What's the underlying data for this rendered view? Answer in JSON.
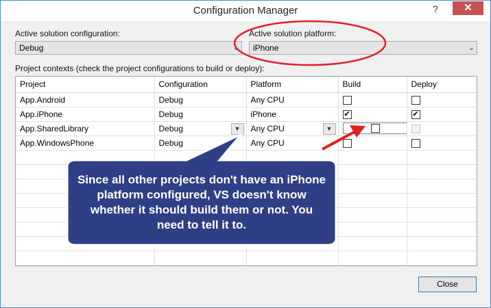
{
  "window": {
    "title": "Configuration Manager",
    "help_label": "?",
    "close_label": "✕"
  },
  "config": {
    "active_config_label": "Active solution configuration:",
    "active_config_value": "Debug",
    "active_platform_label": "Active solution platform:",
    "active_platform_value": "iPhone"
  },
  "grid": {
    "caption": "Project contexts (check the project configurations to build or deploy):",
    "headers": [
      "Project",
      "Configuration",
      "Platform",
      "Build",
      "Deploy"
    ],
    "rows": [
      {
        "project": "App.Android",
        "configuration": "Debug",
        "platform": "Any CPU",
        "build": false,
        "deploy": false,
        "deploy_enabled": true
      },
      {
        "project": "App.iPhone",
        "configuration": "Debug",
        "platform": "iPhone",
        "build": true,
        "deploy": true,
        "deploy_enabled": true
      },
      {
        "project": "App.SharedLibrary",
        "configuration": "Debug",
        "platform": "Any CPU",
        "build": false,
        "deploy": false,
        "deploy_enabled": false
      },
      {
        "project": "App.WindowsPhone",
        "configuration": "Debug",
        "platform": "Any CPU",
        "build": false,
        "deploy": false,
        "deploy_enabled": true
      }
    ]
  },
  "annotation": {
    "callout_text": "Since all other projects don't have an iPhone platform configured, VS doesn't know whether it should build them or not. You need to tell it to."
  },
  "buttons": {
    "close_label": "Close"
  },
  "colors": {
    "highlight_ellipse": "#e0202a",
    "callout_fill": "#2f3f86",
    "callout_border": "#ffffff",
    "arrow": "#e02020",
    "close_button_bg": "#c75050"
  }
}
